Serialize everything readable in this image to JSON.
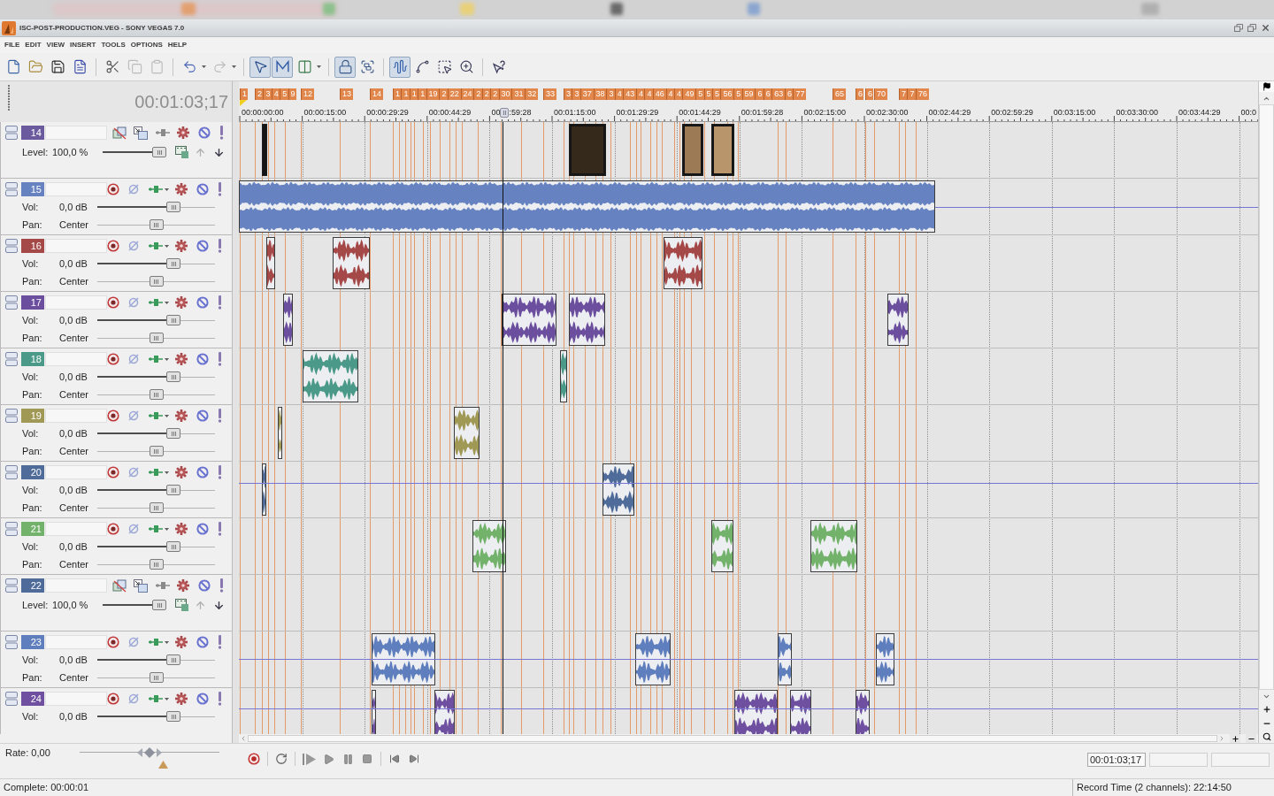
{
  "window": {
    "title": "ISC-POST-PRODUCTION.VEG - SONY VEGAS 7.0"
  },
  "menu": [
    "FILE",
    "EDIT",
    "VIEW",
    "INSERT",
    "TOOLS",
    "OPTIONS",
    "HELP"
  ],
  "toolbar": [
    [
      {
        "pressed": false,
        "disabled": false
      },
      {
        "pressed": false,
        "disabled": false
      },
      {
        "pressed": false,
        "disabled": false
      },
      {
        "pressed": false,
        "disabled": false
      }
    ],
    [
      {
        "pressed": false,
        "disabled": false
      },
      {
        "pressed": false,
        "disabled": true
      },
      {
        "pressed": false,
        "disabled": true
      }
    ],
    [
      {
        "pressed": false,
        "disabled": false,
        "dropdown": true
      },
      {
        "pressed": false,
        "disabled": true,
        "dropdown": true
      }
    ],
    [
      {
        "pressed": true,
        "disabled": false
      },
      {
        "pressed": true,
        "disabled": false
      },
      {
        "pressed": false,
        "disabled": false,
        "dropdown": true
      }
    ],
    [
      {
        "pressed": true,
        "disabled": false
      },
      {
        "pressed": false,
        "disabled": false
      }
    ],
    [
      {
        "pressed": true,
        "disabled": false
      },
      {
        "pressed": false,
        "disabled": false
      },
      {
        "pressed": false,
        "disabled": false
      },
      {
        "pressed": false,
        "disabled": false
      }
    ],
    [
      {
        "pressed": false,
        "disabled": false
      }
    ]
  ],
  "timecode": "00:01:03;17",
  "markers": [
    {
      "label": "1"
    },
    {
      "label": "2"
    },
    {
      "label": "3"
    },
    {
      "label": "4"
    },
    {
      "label": "5"
    },
    {
      "label": "9"
    },
    {
      "label": "12"
    },
    {
      "label": "13"
    },
    {
      "label": "14"
    },
    {
      "label": "1"
    },
    {
      "label": "1"
    },
    {
      "label": "1"
    },
    {
      "label": "1"
    },
    {
      "label": "19"
    },
    {
      "label": "2"
    },
    {
      "label": "22"
    },
    {
      "label": "24"
    },
    {
      "label": "2"
    },
    {
      "label": "2"
    },
    {
      "label": "2"
    },
    {
      "label": "30"
    },
    {
      "label": "31"
    },
    {
      "label": "32"
    },
    {
      "label": "33"
    },
    {
      "label": "3"
    },
    {
      "label": "3"
    },
    {
      "label": "37"
    },
    {
      "label": "38"
    },
    {
      "label": "3"
    },
    {
      "label": "4"
    },
    {
      "label": "43"
    },
    {
      "label": "4"
    },
    {
      "label": "4"
    },
    {
      "label": "46"
    },
    {
      "label": "4"
    },
    {
      "label": "4"
    },
    {
      "label": "49"
    },
    {
      "label": "5"
    },
    {
      "label": "5"
    },
    {
      "label": "5"
    },
    {
      "label": "56"
    },
    {
      "label": "5"
    },
    {
      "label": "59"
    },
    {
      "label": "6"
    },
    {
      "label": "6"
    },
    {
      "label": "63"
    },
    {
      "label": "6"
    },
    {
      "label": "77"
    },
    {
      "label": "65"
    },
    {
      "label": "6"
    },
    {
      "label": "6"
    },
    {
      "label": "70"
    },
    {
      "label": "7"
    },
    {
      "label": "7"
    },
    {
      "label": "76"
    }
  ],
  "ruler": [
    {
      "text": "00:00:00:00"
    },
    {
      "text": "00:00:15:00"
    },
    {
      "text": "00:00:29:29"
    },
    {
      "text": "00:00:44:29"
    },
    {
      "text": "00",
      "after_cursor": ":59:28"
    },
    {
      "text": "00:01:15:00"
    },
    {
      "text": "00:01:29:29"
    },
    {
      "text": "00:01:44:29"
    },
    {
      "text": "00:01:59:28"
    },
    {
      "text": "00:02:15:00"
    },
    {
      "text": "00:02:30:00"
    },
    {
      "text": "00:02:44:29"
    },
    {
      "text": "00:02:59:29"
    },
    {
      "text": "00:03:15:00"
    },
    {
      "text": "00:03:30:00"
    },
    {
      "text": "00:03:44:29"
    },
    {
      "text": "00:0"
    }
  ],
  "tracks": [
    {
      "number": "14",
      "kind": "video",
      "color": "#6c5a9e",
      "composite": {
        "label": "Level:",
        "reading": "100,0 %",
        "level": 1
      },
      "clips": [
        {
          "kind": "video"
        },
        {
          "kind": "video"
        },
        {
          "kind": "video"
        },
        {
          "kind": "video"
        }
      ]
    },
    {
      "number": "15",
      "kind": "audio",
      "color": "#6682c0",
      "envelope": true,
      "volume": {
        "label": "Vol:",
        "reading": "0,0 dB",
        "level": 0.67
      },
      "pan": {
        "label": "Pan:",
        "reading": "Center",
        "level": 0.5
      },
      "clips": [
        {
          "kind": "audio"
        }
      ]
    },
    {
      "number": "16",
      "kind": "audio",
      "color": "#a54848",
      "envelope": false,
      "volume": {
        "label": "Vol:",
        "reading": "0,0 dB",
        "level": 0.67
      },
      "pan": {
        "label": "Pan:",
        "reading": "Center",
        "level": 0.5
      },
      "clips": [
        {
          "kind": "audio"
        },
        {
          "kind": "audio"
        },
        {
          "kind": "audio"
        }
      ]
    },
    {
      "number": "17",
      "kind": "audio",
      "color": "#6b4f9e",
      "envelope": false,
      "volume": {
        "label": "Vol:",
        "reading": "0,0 dB",
        "level": 0.67
      },
      "pan": {
        "label": "Pan:",
        "reading": "Center",
        "level": 0.5
      },
      "clips": [
        {
          "kind": "audio"
        },
        {
          "kind": "audio"
        },
        {
          "kind": "audio"
        },
        {
          "kind": "audio"
        }
      ]
    },
    {
      "number": "18",
      "kind": "audio",
      "color": "#4b9a89",
      "envelope": false,
      "volume": {
        "label": "Vol:",
        "reading": "0,0 dB",
        "level": 0.67
      },
      "pan": {
        "label": "Pan:",
        "reading": "Center",
        "level": 0.5
      },
      "clips": [
        {
          "kind": "audio"
        },
        {
          "kind": "audio"
        }
      ]
    },
    {
      "number": "19",
      "kind": "audio",
      "color": "#a09855",
      "envelope": false,
      "volume": {
        "label": "Vol:",
        "reading": "0,0 dB",
        "level": 0.67
      },
      "pan": {
        "label": "Pan:",
        "reading": "Center",
        "level": 0.5
      },
      "clips": [
        {
          "kind": "audio"
        },
        {
          "kind": "audio"
        }
      ]
    },
    {
      "number": "20",
      "kind": "audio",
      "color": "#4f6b99",
      "envelope": true,
      "volume": {
        "label": "Vol:",
        "reading": "0,0 dB",
        "level": 0.67
      },
      "pan": {
        "label": "Pan:",
        "reading": "Center",
        "level": 0.5
      },
      "clips": [
        {
          "kind": "audio"
        },
        {
          "kind": "audio"
        }
      ]
    },
    {
      "number": "21",
      "kind": "audio",
      "color": "#72b26a",
      "envelope": false,
      "volume": {
        "label": "Vol:",
        "reading": "0,0 dB",
        "level": 0.67
      },
      "pan": {
        "label": "Pan:",
        "reading": "Center",
        "level": 0.5
      },
      "clips": [
        {
          "kind": "audio"
        },
        {
          "kind": "audio"
        },
        {
          "kind": "audio"
        }
      ]
    },
    {
      "number": "22",
      "kind": "video",
      "color": "#4f6b99",
      "composite": {
        "label": "Level:",
        "reading": "100,0 %",
        "level": 1
      }
    },
    {
      "number": "23",
      "kind": "audio",
      "color": "#5f7ebd",
      "envelope": true,
      "volume": {
        "label": "Vol:",
        "reading": "0,0 dB",
        "level": 0.67
      },
      "pan": {
        "label": "Pan:",
        "reading": "Center",
        "level": 0.5
      },
      "clips": [
        {
          "kind": "audio"
        },
        {
          "kind": "audio"
        },
        {
          "kind": "audio"
        },
        {
          "kind": "audio"
        }
      ]
    },
    {
      "number": "24",
      "kind": "audio",
      "color": "#6e4fa0",
      "envelope": true,
      "volume": {
        "label": "Vol:",
        "reading": "0,0 dB",
        "level": 0.67
      },
      "clips": [
        {
          "kind": "audio"
        },
        {
          "kind": "audio"
        },
        {
          "kind": "audio"
        },
        {
          "kind": "audio"
        },
        {
          "kind": "audio"
        }
      ]
    }
  ],
  "rate": {
    "label": "Rate: 0,00",
    "level": 0.5
  },
  "transport": {
    "timecode": "00:01:03;17"
  },
  "status": {
    "progress": "Complete: 00:00:01",
    "record_time": "Record Time (2 channels): 22:14:50"
  }
}
